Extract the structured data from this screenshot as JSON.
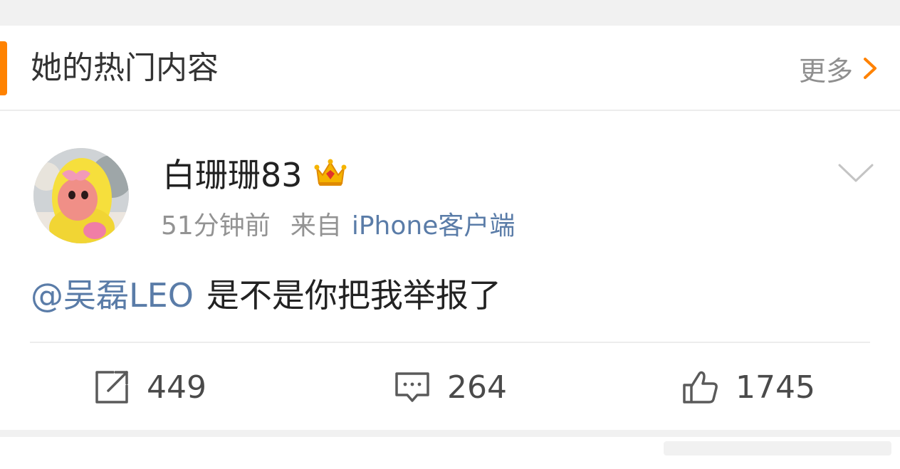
{
  "header": {
    "title": "她的热门内容",
    "more_label": "更多",
    "accent_color": "#ff8200"
  },
  "post": {
    "author": {
      "name": "白珊珊83",
      "badge_icon": "crown-badge-icon",
      "avatar": "avatar-yellow-plush-doll"
    },
    "time": "51分钟前",
    "source_prefix": "来自",
    "source_client": "iPhone客户端",
    "mention": "@吴磊LEO",
    "text": "是不是你把我举报了",
    "link_color": "#5a7ca8"
  },
  "actions": {
    "repost": {
      "icon": "repost-icon",
      "count": "449"
    },
    "comment": {
      "icon": "comment-icon",
      "count": "264"
    },
    "like": {
      "icon": "like-thumb-icon",
      "count": "1745"
    }
  }
}
